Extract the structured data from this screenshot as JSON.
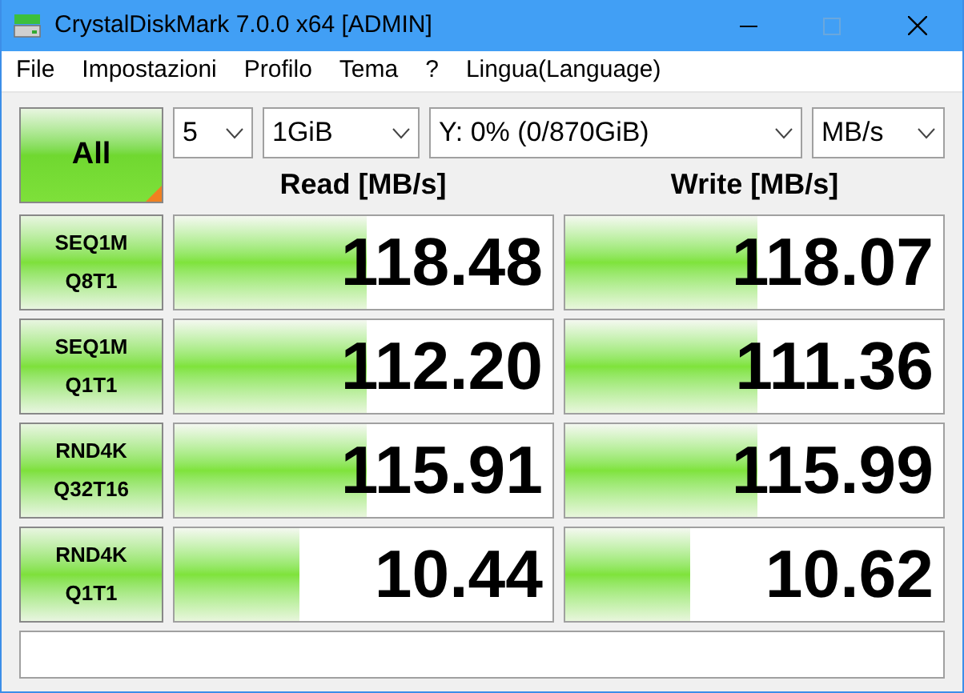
{
  "window": {
    "title": "CrystalDiskMark 7.0.0 x64 [ADMIN]"
  },
  "menu": [
    "File",
    "Impostazioni",
    "Profilo",
    "Tema",
    "?",
    "Lingua(Language)"
  ],
  "all_button": {
    "label": "All"
  },
  "selects": [
    {
      "value": "5"
    },
    {
      "value": "1GiB"
    },
    {
      "value": "Y: 0% (0/870GiB)"
    },
    {
      "value": "MB/s"
    }
  ],
  "headers": [
    "Read [MB/s]",
    "Write [MB/s]"
  ],
  "tests": [
    {
      "label": [
        "SEQ1M",
        "Q8T1"
      ],
      "read": {
        "value": "118.48",
        "level": 0.51
      },
      "write": {
        "value": "118.07",
        "level": 0.51
      }
    },
    {
      "label": [
        "SEQ1M",
        "Q1T1"
      ],
      "read": {
        "value": "112.20",
        "level": 0.51
      },
      "write": {
        "value": "111.36",
        "level": 0.51
      }
    },
    {
      "label": [
        "RND4K",
        "Q32T16"
      ],
      "read": {
        "value": "115.91",
        "level": 0.51
      },
      "write": {
        "value": "115.99",
        "level": 0.51
      }
    },
    {
      "label": [
        "RND4K",
        "Q1T1"
      ],
      "read": {
        "value": "10.44",
        "level": 0.33
      },
      "write": {
        "value": "10.62",
        "level": 0.33
      }
    }
  ]
}
